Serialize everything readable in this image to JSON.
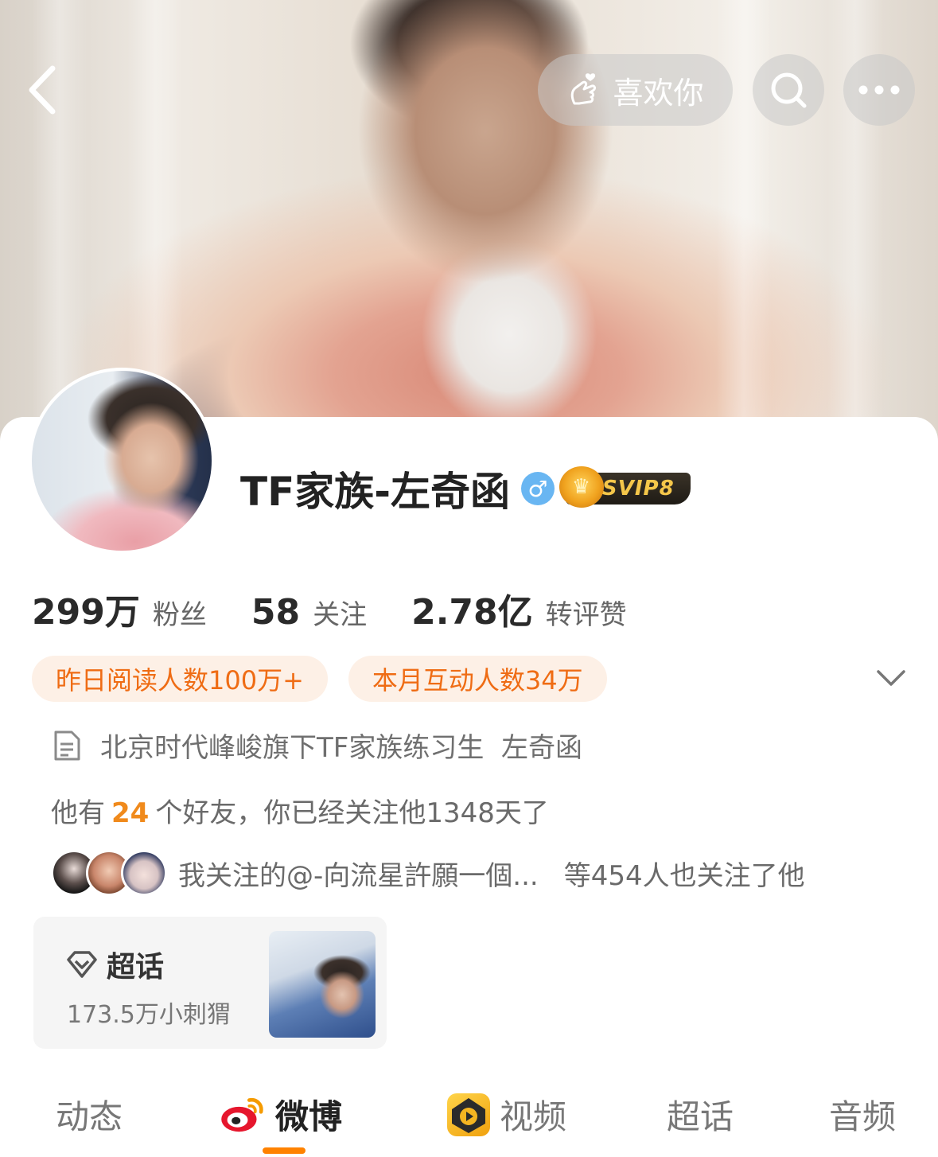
{
  "header": {
    "like_label": "喜欢你"
  },
  "profile": {
    "name": "TF家族-左奇函",
    "gender_symbol": "♂",
    "vip_badge": "SVIP8",
    "stats": [
      {
        "value": "299万",
        "label": "粉丝"
      },
      {
        "value": "58",
        "label": "关注"
      },
      {
        "value": "2.78亿",
        "label": "转评赞"
      }
    ],
    "tags": [
      "昨日阅读人数100万+",
      "本月互动人数34万"
    ],
    "bio": "北京时代峰峻旗下TF家族练习生  左奇函",
    "friends": {
      "prefix": "他有",
      "count": "24",
      "suffix": "个好友，你已经关注他1348天了"
    },
    "mutual": {
      "text": "我关注的@-向流星許願一個...",
      "count_text": "等454人也关注了他"
    }
  },
  "chaohua": {
    "title": "超话",
    "subtitle": "173.5万小刺猬"
  },
  "tabs": [
    {
      "label": "动态",
      "active": false
    },
    {
      "label": "微博",
      "active": true
    },
    {
      "label": "视频",
      "active": false
    },
    {
      "label": "超话",
      "active": false
    },
    {
      "label": "音频",
      "active": false
    }
  ],
  "colors": {
    "accent": "#ff8200",
    "tag_text": "#ef6c14",
    "tag_bg": "#fdf0e6",
    "highlight": "#f08a1c"
  }
}
